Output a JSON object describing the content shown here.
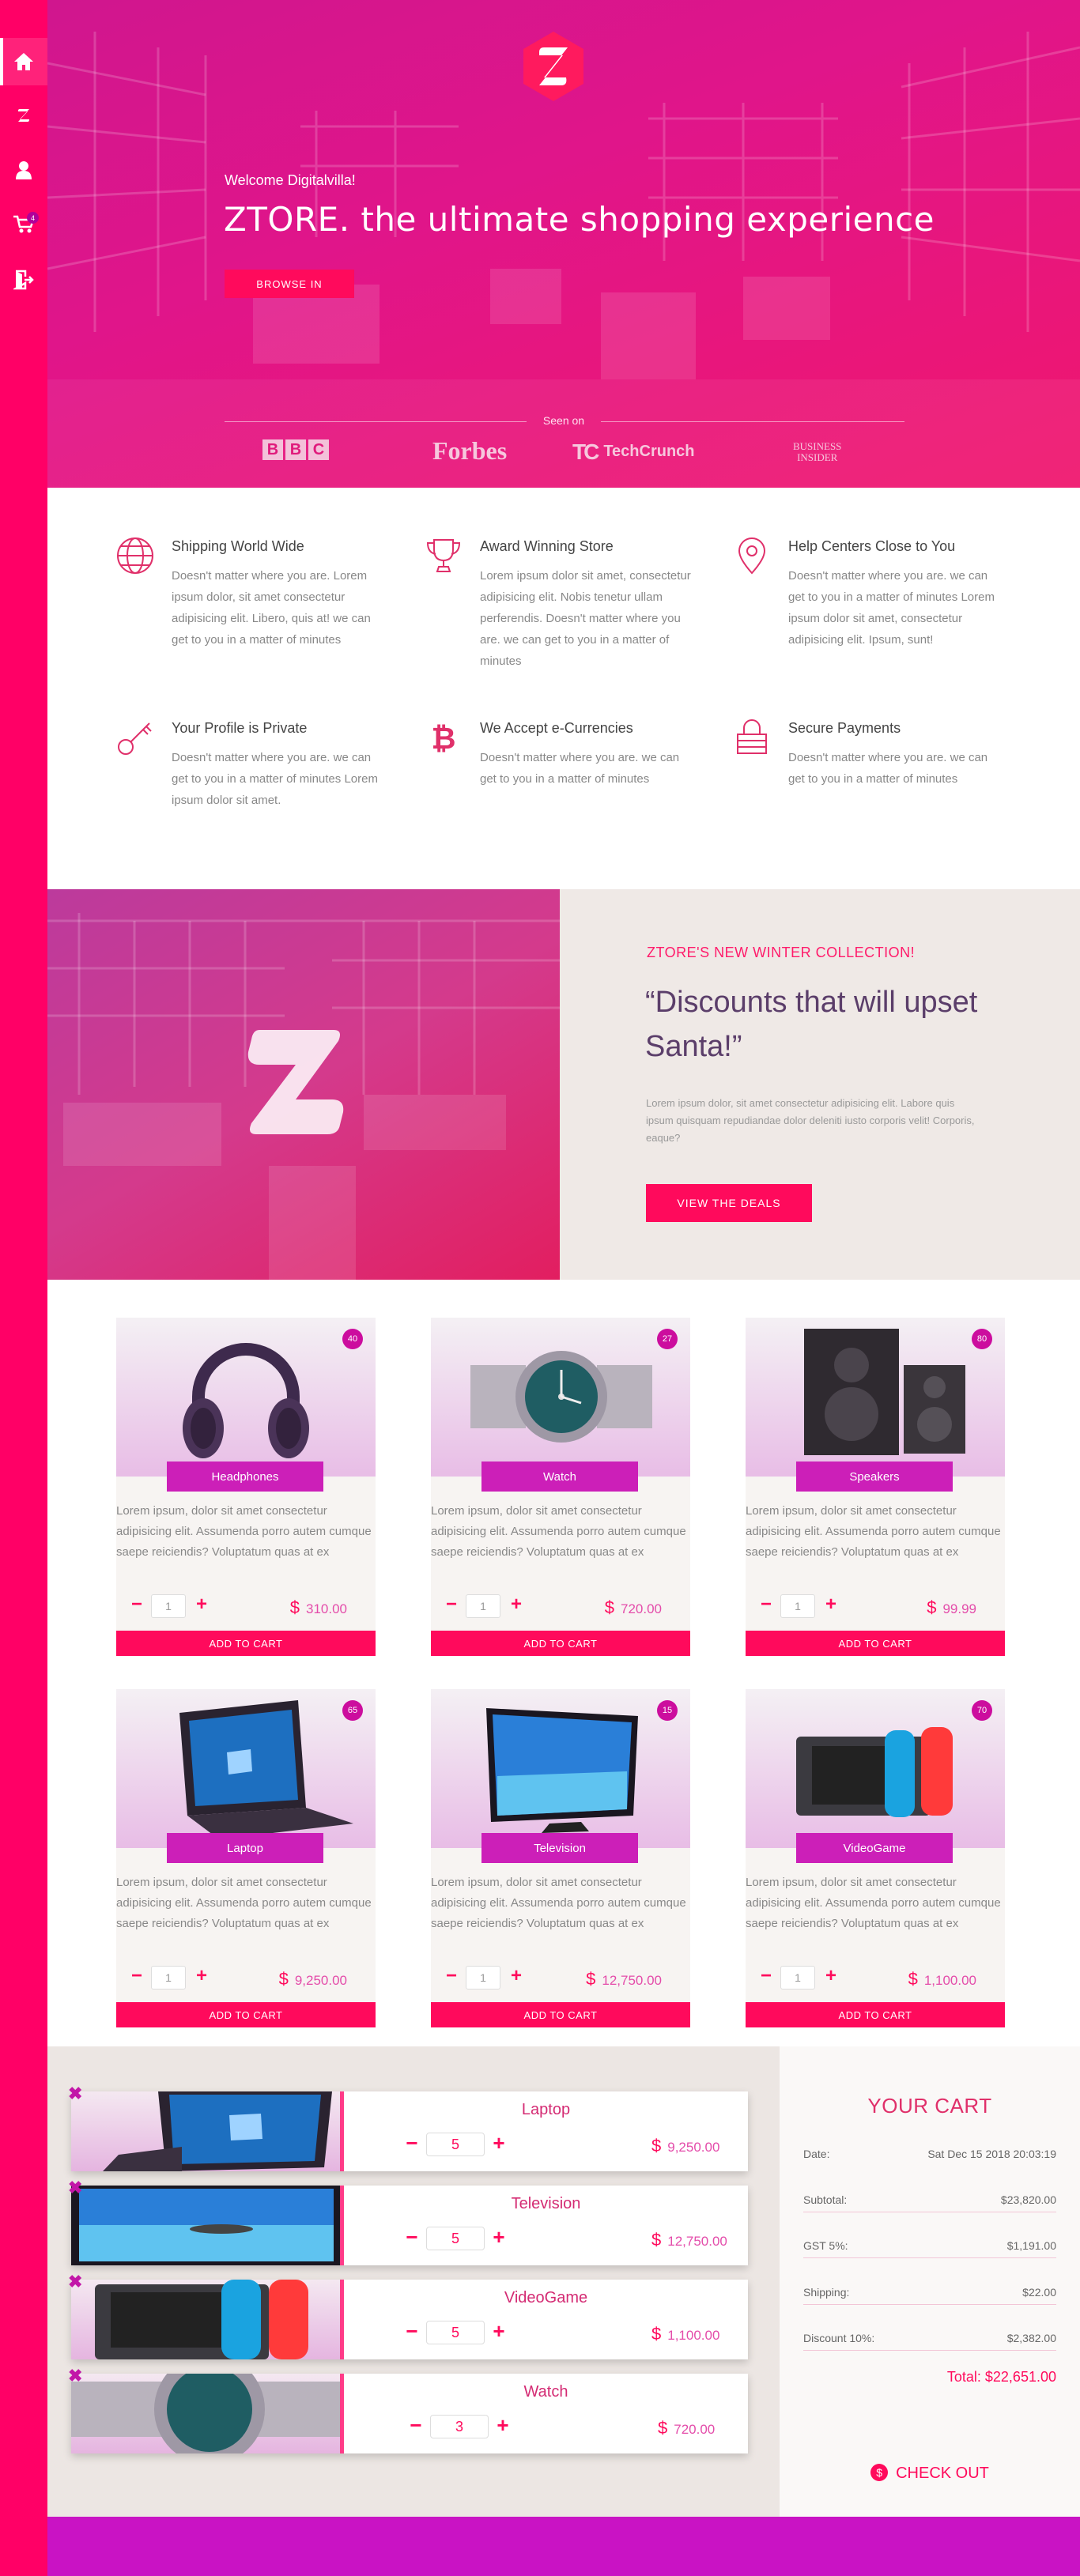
{
  "sidebar": {
    "items": [
      {
        "icon": "home-icon",
        "active": true
      },
      {
        "icon": "z-logo-icon"
      },
      {
        "icon": "user-icon"
      },
      {
        "icon": "cart-icon",
        "badge": "4"
      },
      {
        "icon": "logout-icon"
      }
    ]
  },
  "hero": {
    "logo_letter": "Z",
    "welcome": "Welcome Digitalvilla!",
    "title": "ZTORE. the ultimate shopping experience",
    "button": "BROWSE IN",
    "seen_on": "Seen on",
    "brands": [
      "BBC",
      "Forbes",
      "TechCrunch",
      "BUSINESS",
      "INSIDER"
    ]
  },
  "features": [
    {
      "icon": "globe-icon",
      "title": "Shipping World Wide",
      "text": "Doesn't matter where you are. Lorem ipsum dolor, sit amet consectetur adipisicing elit. Libero, quis at! we can get to you in a matter of minutes"
    },
    {
      "icon": "trophy-icon",
      "title": "Award Winning Store",
      "text": "Lorem ipsum dolor sit amet, consectetur adipisicing elit. Nobis tenetur ullam perferendis. Doesn't matter where you are. we can get to you in a matter of minutes"
    },
    {
      "icon": "location-pin-icon",
      "title": "Help Centers Close to You",
      "text": "Doesn't matter where you are. we can get to you in a matter of minutes Lorem ipsum dolor sit amet, consectetur adipisicing elit. Ipsum, sunt!"
    },
    {
      "icon": "key-icon",
      "title": "Your Profile is Private",
      "text": "Doesn't matter where you are. we can get to you in a matter of minutes Lorem ipsum dolor sit amet."
    },
    {
      "icon": "bitcoin-icon",
      "title": "We Accept e-Currencies",
      "text": "Doesn't matter where you are. we can get to you in a matter of minutes"
    },
    {
      "icon": "padlock-icon",
      "title": "Secure Payments",
      "text": "Doesn't matter where you are. we can get to you in a matter of minutes"
    }
  ],
  "promo": {
    "kicker": "ZTORE'S NEW WINTER COLLECTION!",
    "quote": "“Discounts that will upset Santa!”",
    "text": "Lorem ipsum dolor, sit amet consectetur adipisicing elit. Labore quis ipsum quisquam repudiandae dolor deleniti iusto corporis velit! Corporis, eaque?",
    "button": "VIEW THE DEALS"
  },
  "products": [
    {
      "name": "Headphones",
      "badge": "40",
      "desc": "Lorem ipsum, dolor sit amet consectetur adipisicing elit. Assumenda porro autem cumque saepe reiciendis? Voluptatum quas at ex",
      "qty": "1",
      "price": "310.00",
      "button": "ADD TO CART"
    },
    {
      "name": "Watch",
      "badge": "27",
      "desc": "Lorem ipsum, dolor sit amet consectetur adipisicing elit. Assumenda porro autem cumque saepe reiciendis? Voluptatum quas at ex",
      "qty": "1",
      "price": "720.00",
      "button": "ADD TO CART"
    },
    {
      "name": "Speakers",
      "badge": "80",
      "desc": "Lorem ipsum, dolor sit amet consectetur adipisicing elit. Assumenda porro autem cumque saepe reiciendis? Voluptatum quas at ex",
      "qty": "1",
      "price": "99.99",
      "button": "ADD TO CART"
    },
    {
      "name": "Laptop",
      "badge": "65",
      "desc": "Lorem ipsum, dolor sit amet consectetur adipisicing elit. Assumenda porro autem cumque saepe reiciendis? Voluptatum quas at ex",
      "qty": "1",
      "price": "9,250.00",
      "button": "ADD TO CART"
    },
    {
      "name": "Television",
      "badge": "15",
      "desc": "Lorem ipsum, dolor sit amet consectetur adipisicing elit. Assumenda porro autem cumque saepe reiciendis? Voluptatum quas at ex",
      "qty": "1",
      "price": "12,750.00",
      "button": "ADD TO CART"
    },
    {
      "name": "VideoGame",
      "badge": "70",
      "desc": "Lorem ipsum, dolor sit amet consectetur adipisicing elit. Assumenda porro autem cumque saepe reiciendis? Voluptatum quas at ex",
      "qty": "1",
      "price": "1,100.00",
      "button": "ADD TO CART"
    }
  ],
  "currency_symbol": "$",
  "cart": {
    "items": [
      {
        "name": "Laptop",
        "qty": "5",
        "price": "9,250.00"
      },
      {
        "name": "Television",
        "qty": "5",
        "price": "12,750.00"
      },
      {
        "name": "VideoGame",
        "qty": "5",
        "price": "1,100.00"
      },
      {
        "name": "Watch",
        "qty": "3",
        "price": "720.00"
      }
    ],
    "remove_symbol": "✖",
    "summary": {
      "title": "YOUR CART",
      "rows": [
        {
          "label": "Date:",
          "value": "Sat Dec 15 2018 20:03:19"
        },
        {
          "label": "Subtotal:",
          "value": "$23,820.00"
        },
        {
          "label": "GST 5%:",
          "value": "$1,191.00"
        },
        {
          "label": "Shipping:",
          "value": "$22.00"
        },
        {
          "label": "Discount 10%:",
          "value": "$2,382.00"
        }
      ],
      "total": "Total: $22,651.00",
      "checkout": "CHECK OUT",
      "checkout_icon": "$"
    }
  },
  "colors": {
    "brand": "#ff0066",
    "accent": "#ff0a5c",
    "purple": "#cc1fb8"
  }
}
